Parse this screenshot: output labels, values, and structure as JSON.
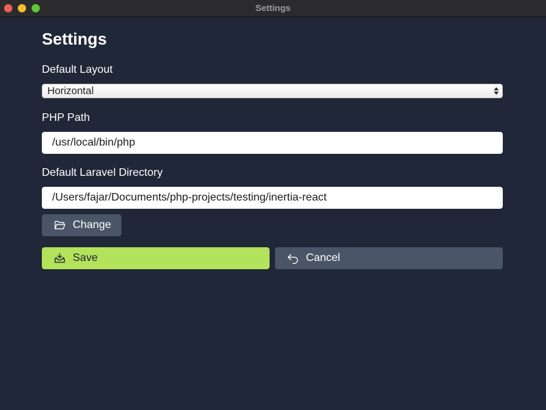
{
  "window": {
    "title": "Settings"
  },
  "page": {
    "title": "Settings"
  },
  "layout_setting": {
    "label": "Default Layout",
    "selected": "Horizontal"
  },
  "php_path": {
    "label": "PHP Path",
    "value": "/usr/local/bin/php"
  },
  "laravel_dir": {
    "label": "Default Laravel Directory",
    "value": "/Users/fajar/Documents/php-projects/testing/inertia-react"
  },
  "buttons": {
    "change": {
      "label": "Change",
      "icon": "folder-open-icon"
    },
    "save": {
      "label": "Save",
      "icon": "inbox-download-icon"
    },
    "cancel": {
      "label": "Cancel",
      "icon": "undo-arrow-icon"
    }
  },
  "colors": {
    "background": "#1f2738",
    "save_accent": "#b3e35a",
    "secondary_button": "#4a5567"
  }
}
